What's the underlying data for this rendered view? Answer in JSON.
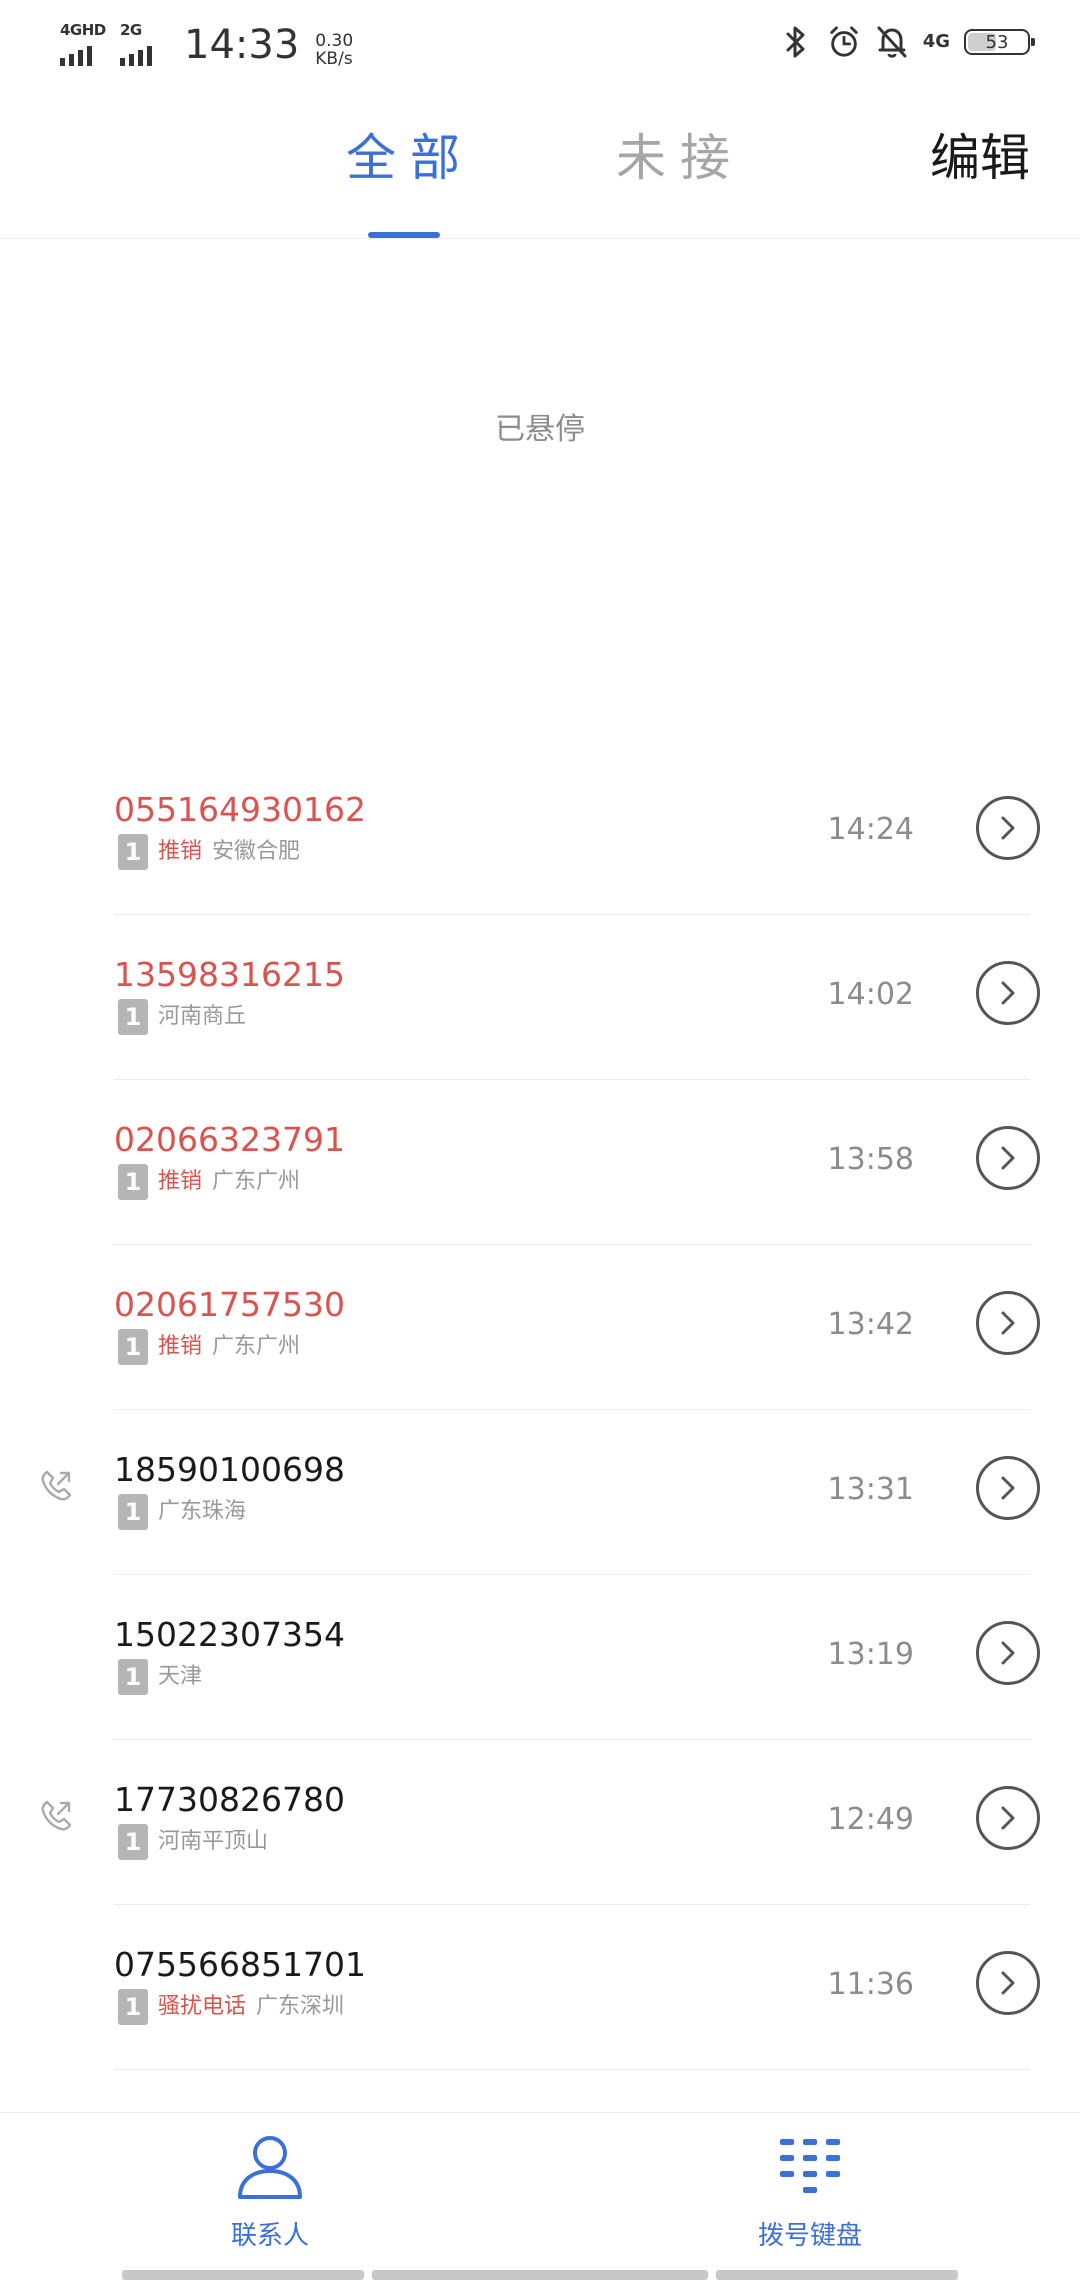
{
  "status_bar": {
    "sim1_label": "4GHD",
    "sim2_label": "2G",
    "time": "14:33",
    "speed_value": "0.30",
    "speed_unit": "KB/s",
    "net_label": "4G",
    "battery": "53",
    "icons": [
      "bluetooth-icon",
      "alarm-icon",
      "bell-off-icon"
    ]
  },
  "tabs": {
    "all": "全部",
    "missed": "未接",
    "selected": "all"
  },
  "edit_label": "编辑",
  "paused_text": "已悬停",
  "calls": [
    {
      "number": "055164930162",
      "spam": true,
      "sim": "1",
      "tag": "推销",
      "location": "安徽合肥",
      "time": "14:24",
      "direction": "none"
    },
    {
      "number": "13598316215",
      "spam": true,
      "sim": "1",
      "tag": "",
      "location": "河南商丘",
      "time": "14:02",
      "direction": "none"
    },
    {
      "number": "02066323791",
      "spam": true,
      "sim": "1",
      "tag": "推销",
      "location": "广东广州",
      "time": "13:58",
      "direction": "none"
    },
    {
      "number": "02061757530",
      "spam": true,
      "sim": "1",
      "tag": "推销",
      "location": "广东广州",
      "time": "13:42",
      "direction": "none"
    },
    {
      "number": "18590100698",
      "spam": false,
      "sim": "1",
      "tag": "",
      "location": "广东珠海",
      "time": "13:31",
      "direction": "outgoing"
    },
    {
      "number": "15022307354",
      "spam": false,
      "sim": "1",
      "tag": "",
      "location": "天津",
      "time": "13:19",
      "direction": "none"
    },
    {
      "number": "17730826780",
      "spam": false,
      "sim": "1",
      "tag": "",
      "location": "河南平顶山",
      "time": "12:49",
      "direction": "outgoing"
    },
    {
      "number": "075566851701",
      "spam": false,
      "sim": "1",
      "tag": "骚扰电话",
      "location": "广东深圳",
      "time": "11:36",
      "direction": "none"
    }
  ],
  "bottom_nav": {
    "contacts": "联系人",
    "dialpad": "拨号键盘"
  },
  "colors": {
    "accent": "#3c6fd8",
    "spam": "#d9534f",
    "muted": "#8c8c8c"
  }
}
